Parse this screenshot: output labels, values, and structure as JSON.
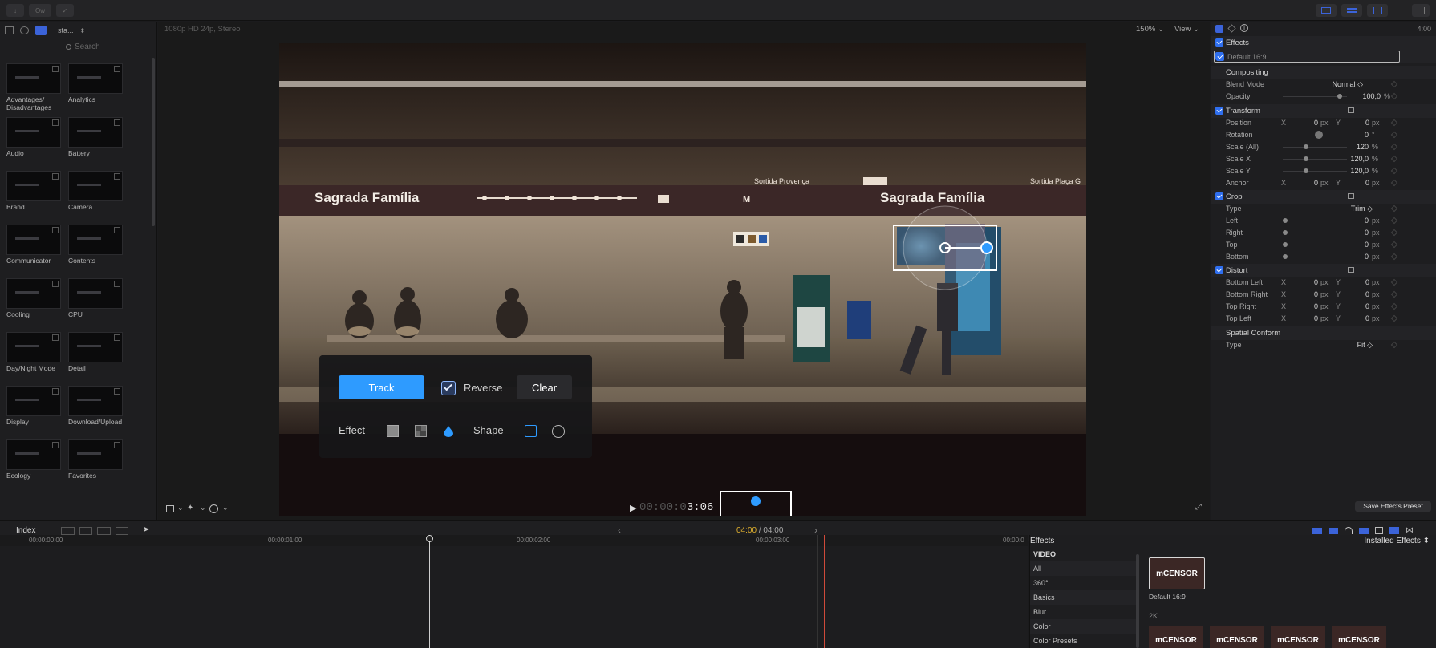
{
  "topbar": {
    "left_btn_1": "↓",
    "left_btn_2": "Ow",
    "left_btn_3": "✓"
  },
  "browser": {
    "library_name": "sta...",
    "search_placeholder": "Search",
    "items": [
      {
        "label": "Advantages/ Disadvantages"
      },
      {
        "label": "Analytics"
      },
      {
        "label": "Audio"
      },
      {
        "label": "Battery"
      },
      {
        "label": "Brand"
      },
      {
        "label": "Camera"
      },
      {
        "label": "Communicator"
      },
      {
        "label": "Contents"
      },
      {
        "label": "Cooling"
      },
      {
        "label": "CPU"
      },
      {
        "label": "Day/Night Mode"
      },
      {
        "label": "Detail"
      },
      {
        "label": "Display"
      },
      {
        "label": "Download/Upload"
      },
      {
        "label": "Ecology"
      },
      {
        "label": "Favorites"
      }
    ]
  },
  "viewer": {
    "format": "1080p HD 24p, Stereo",
    "zoom": "150%",
    "view_label": "View",
    "sign_left": "Sagrada Família",
    "sign_right": "Sagrada Família",
    "sign_small_1": "Sortida Provença",
    "sign_small_2": "Sortida Plaça G",
    "sign_m": "M",
    "timecode_dim": "00:00:0",
    "timecode": "3:06"
  },
  "hud": {
    "track_label": "Track",
    "reverse_label": "Reverse",
    "reverse_checked": true,
    "clear_label": "Clear",
    "effect_label": "Effect",
    "shape_label": "Shape",
    "accent": "#2e9bff"
  },
  "inspector": {
    "duration": "4:00",
    "effects_label": "Effects",
    "preset_name": "Default 16:9",
    "save_label": "Save Effects Preset",
    "rows": {
      "compositing": "Compositing",
      "blend_mode": "Blend Mode",
      "blend_value": "Normal ◇",
      "opacity": "Opacity",
      "opacity_value": "100,0",
      "transform": "Transform",
      "position": "Position",
      "rotation": "Rotation",
      "rotation_value": "0",
      "scale_all": "Scale (All)",
      "scale_all_value": "120",
      "scale_x": "Scale X",
      "scale_x_value": "120,0",
      "scale_y": "Scale Y",
      "scale_y_value": "120,0",
      "anchor": "Anchor",
      "crop": "Crop",
      "type": "Type",
      "crop_type_value": "Trim ◇",
      "left": "Left",
      "right": "Right",
      "top": "Top",
      "bottom": "Bottom",
      "distort": "Distort",
      "bottom_left": "Bottom Left",
      "bottom_right": "Bottom Right",
      "top_right": "Top Right",
      "top_left": "Top Left",
      "spatial_conform": "Spatial Conform",
      "conform_type_value": "Fit ◇",
      "zero": "0",
      "px": "px",
      "pct": "%",
      "deg": "°",
      "x": "X",
      "y": "Y"
    }
  },
  "timeline": {
    "index_label": "Index",
    "position": "04:00",
    "duration": "/ 04:00",
    "ruler": [
      "00:00:00:00",
      "00:00:01:00",
      "00:00:02:00",
      "00:00:03:00",
      "00:00:0"
    ]
  },
  "effects_browser": {
    "title": "Effects",
    "installed_label": "Installed Effects",
    "categories": [
      "VIDEO",
      "All",
      "360°",
      "Basics",
      "Blur",
      "Color",
      "Color Presets"
    ],
    "thumb_text": "mCENSOR",
    "preset_name": "Default 16:9",
    "group_label": "2K"
  }
}
